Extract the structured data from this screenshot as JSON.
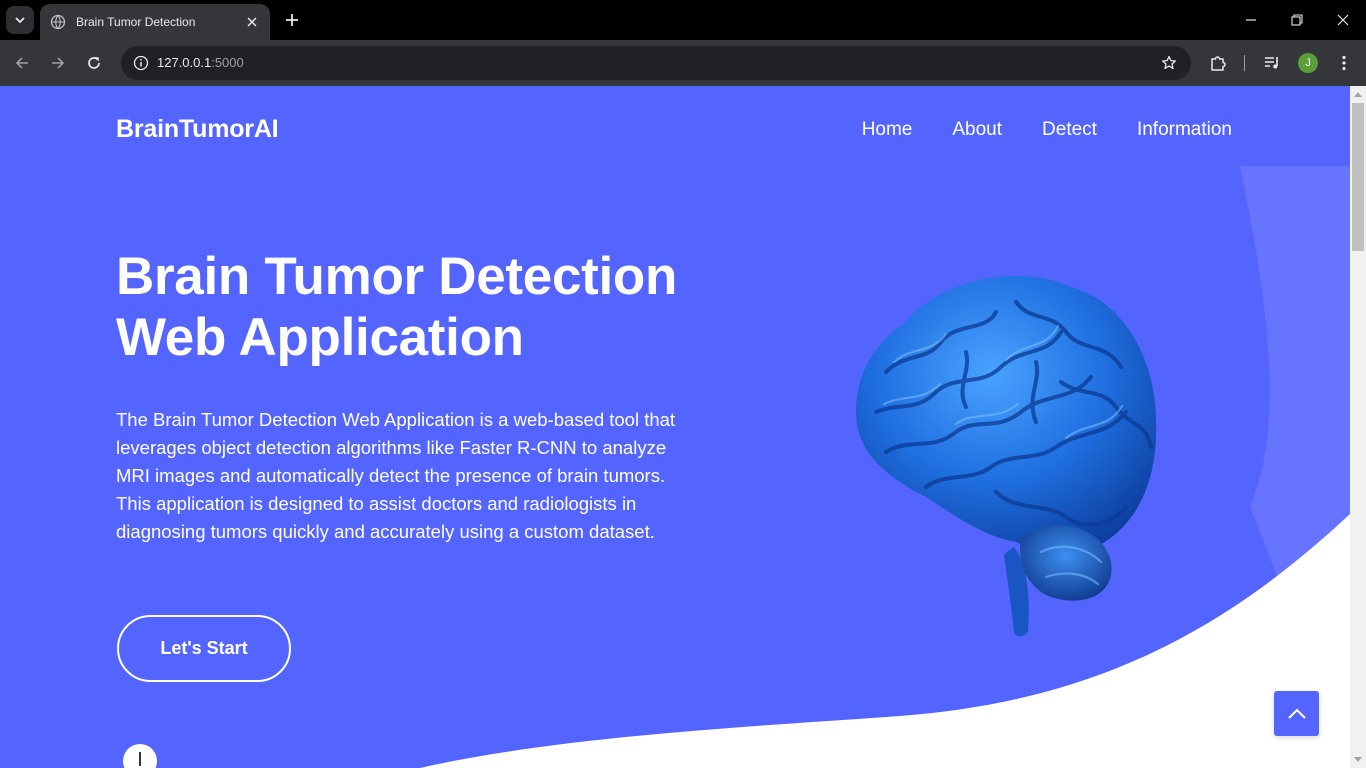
{
  "browser": {
    "tab_title": "Brain Tumor Detection",
    "url_host": "127.0.0.1",
    "url_port": ":5000",
    "profile_initial": "J"
  },
  "page": {
    "logo": "BrainTumorAI",
    "nav": [
      "Home",
      "About",
      "Detect",
      "Information"
    ],
    "hero_title_line1": "Brain Tumor Detection",
    "hero_title_line2": "Web Application",
    "hero_description": "The Brain Tumor Detection Web Application is a web-based tool that leverages object detection algorithms like Faster R-CNN to analyze MRI images and automatically detect the presence of brain tumors. This application is designed to assist doctors and radiologists in diagnosing tumors quickly and accurately using a custom dataset.",
    "cta_label": "Let's Start"
  },
  "colors": {
    "primary": "#5465ff",
    "wave": "#6674ff",
    "white": "#ffffff"
  },
  "icons": [
    "tab-search-icon",
    "globe-icon",
    "close-icon",
    "plus-icon",
    "minimize-icon",
    "restore-icon",
    "back-icon",
    "forward-icon",
    "reload-icon",
    "info-icon",
    "star-icon",
    "extensions-icon",
    "media-icon",
    "menu-icon",
    "chevron-up-icon"
  ]
}
